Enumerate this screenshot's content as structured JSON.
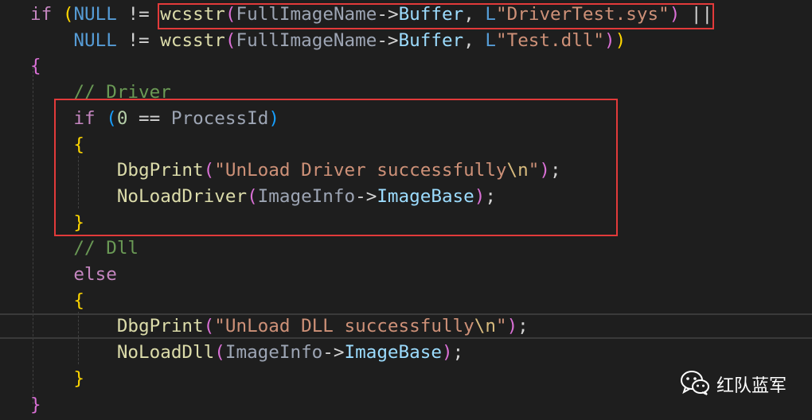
{
  "colors": {
    "background": "#1e1e1e",
    "keyword": "#c586c0",
    "function": "#dcdcaa",
    "variable": "#9cdcfe",
    "parameter": "#9da5b4",
    "constant": "#569cd6",
    "string": "#ce9178",
    "escape": "#d7ba7d",
    "comment": "#6a9955",
    "number": "#b5cea8",
    "text": "#d4d4d4",
    "bracket_gold": "#ffd700",
    "bracket_pink": "#da70d6",
    "bracket_blue": "#179fff",
    "highlight_box": "#e23a3a"
  },
  "code": {
    "lines": [
      [
        {
          "t": "if",
          "c": "keyword"
        },
        {
          "t": " ",
          "c": "text"
        },
        {
          "t": "(",
          "c": "bracket_gold"
        },
        {
          "t": "NULL",
          "c": "constant"
        },
        {
          "t": " != ",
          "c": "text"
        },
        {
          "t": "wcsstr",
          "c": "function"
        },
        {
          "t": "(",
          "c": "bracket_pink"
        },
        {
          "t": "FullImageName",
          "c": "parameter"
        },
        {
          "t": "->",
          "c": "text"
        },
        {
          "t": "Buffer",
          "c": "variable"
        },
        {
          "t": ", ",
          "c": "text"
        },
        {
          "t": "L",
          "c": "constant"
        },
        {
          "t": "\"DriverTest.sys\"",
          "c": "string"
        },
        {
          "t": ")",
          "c": "bracket_pink"
        },
        {
          "t": " ||",
          "c": "text"
        }
      ],
      [
        {
          "t": "    NULL",
          "c": "constant"
        },
        {
          "t": " != ",
          "c": "text"
        },
        {
          "t": "wcsstr",
          "c": "function"
        },
        {
          "t": "(",
          "c": "bracket_pink"
        },
        {
          "t": "FullImageName",
          "c": "parameter"
        },
        {
          "t": "->",
          "c": "text"
        },
        {
          "t": "Buffer",
          "c": "variable"
        },
        {
          "t": ", ",
          "c": "text"
        },
        {
          "t": "L",
          "c": "constant"
        },
        {
          "t": "\"Test.dll\"",
          "c": "string"
        },
        {
          "t": ")",
          "c": "bracket_pink"
        },
        {
          "t": ")",
          "c": "bracket_gold"
        }
      ],
      [
        {
          "t": "{",
          "c": "bracket_pink"
        }
      ],
      [
        {
          "t": "    // Driver",
          "c": "comment"
        }
      ],
      [
        {
          "t": "    if",
          "c": "keyword"
        },
        {
          "t": " ",
          "c": "text"
        },
        {
          "t": "(",
          "c": "bracket_blue"
        },
        {
          "t": "0",
          "c": "number"
        },
        {
          "t": " == ",
          "c": "text"
        },
        {
          "t": "ProcessId",
          "c": "parameter"
        },
        {
          "t": ")",
          "c": "bracket_blue"
        }
      ],
      [
        {
          "t": "    {",
          "c": "bracket_gold"
        }
      ],
      [
        {
          "t": "        DbgPrint",
          "c": "function"
        },
        {
          "t": "(",
          "c": "bracket_pink"
        },
        {
          "t": "\"UnLoad Driver successfully",
          "c": "string"
        },
        {
          "t": "\\n",
          "c": "escape"
        },
        {
          "t": "\"",
          "c": "string"
        },
        {
          "t": ")",
          "c": "bracket_pink"
        },
        {
          "t": ";",
          "c": "text"
        }
      ],
      [
        {
          "t": "        NoLoadDriver",
          "c": "function"
        },
        {
          "t": "(",
          "c": "bracket_pink"
        },
        {
          "t": "ImageInfo",
          "c": "parameter"
        },
        {
          "t": "->",
          "c": "text"
        },
        {
          "t": "ImageBase",
          "c": "variable"
        },
        {
          "t": ")",
          "c": "bracket_pink"
        },
        {
          "t": ";",
          "c": "text"
        }
      ],
      [
        {
          "t": "    }",
          "c": "bracket_gold"
        }
      ],
      [
        {
          "t": "    // Dll",
          "c": "comment"
        }
      ],
      [
        {
          "t": "    else",
          "c": "keyword"
        }
      ],
      [
        {
          "t": "    {",
          "c": "bracket_gold"
        }
      ],
      [
        {
          "t": "        DbgPrint",
          "c": "function"
        },
        {
          "t": "(",
          "c": "bracket_pink"
        },
        {
          "t": "\"UnLoad DLL successfully",
          "c": "string"
        },
        {
          "t": "\\n",
          "c": "escape"
        },
        {
          "t": "\"",
          "c": "string"
        },
        {
          "t": ")",
          "c": "bracket_pink"
        },
        {
          "t": ";",
          "c": "text"
        }
      ],
      [
        {
          "t": "        NoLoadDll",
          "c": "function"
        },
        {
          "t": "(",
          "c": "bracket_pink"
        },
        {
          "t": "ImageInfo",
          "c": "parameter"
        },
        {
          "t": "->",
          "c": "text"
        },
        {
          "t": "ImageBase",
          "c": "variable"
        },
        {
          "t": ")",
          "c": "bracket_pink"
        },
        {
          "t": ";",
          "c": "text"
        }
      ],
      [
        {
          "t": "    }",
          "c": "bracket_gold"
        }
      ],
      [
        {
          "t": "}",
          "c": "bracket_pink"
        }
      ]
    ]
  },
  "watermark": {
    "icon": "wechat-icon",
    "text": "红队蓝军"
  }
}
